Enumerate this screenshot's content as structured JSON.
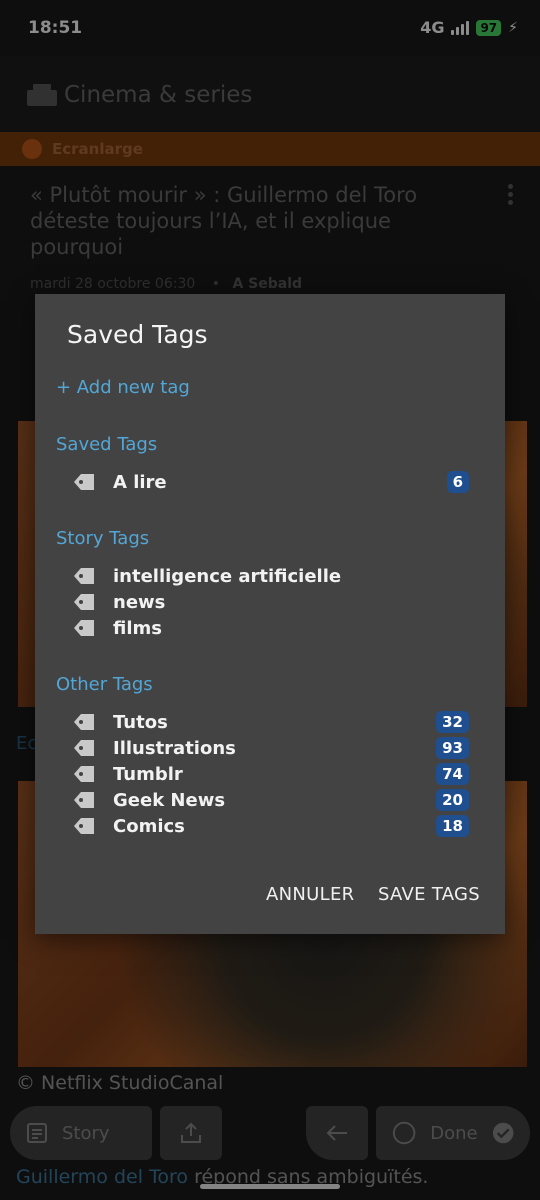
{
  "status_bar": {
    "time": "18:51",
    "network": "4G",
    "battery": "97"
  },
  "header": {
    "title": "Cinema & series"
  },
  "feed": {
    "name": "Ecranlarge"
  },
  "story": {
    "title": "« Plutôt mourir » : Guillermo del Toro déteste toujours l’IA, et il explique pourquoi",
    "date": "mardi 28 octobre 06:30",
    "separator": "•",
    "author": "A Sebald",
    "side_link": "Ec",
    "caption": "© Netflix StudioCanal",
    "body_link": "Guillermo del Toro",
    "body_rest": " répond sans ambiguïtés."
  },
  "bottom_bar": {
    "story_label": "Story",
    "done_label": "Done"
  },
  "dialog": {
    "title": "Saved Tags",
    "add_tag": "+ Add new tag",
    "saved_section": "Saved Tags",
    "saved_tags": [
      {
        "label": "A lire",
        "count": "6"
      }
    ],
    "story_section": "Story Tags",
    "story_tags": [
      {
        "label": "intelligence artificielle"
      },
      {
        "label": "news"
      },
      {
        "label": "films"
      }
    ],
    "other_section": "Other Tags",
    "other_tags": [
      {
        "label": "Tutos",
        "count": "32"
      },
      {
        "label": "Illustrations",
        "count": "93"
      },
      {
        "label": "Tumblr",
        "count": "74"
      },
      {
        "label": "Geek News",
        "count": "20"
      },
      {
        "label": "Comics",
        "count": "18"
      }
    ],
    "cancel_label": "ANNULER",
    "save_label": "SAVE TAGS"
  },
  "colors": {
    "accent": "#53a6d6",
    "count_badge": "#1f4f8f",
    "dialog_bg": "#434343",
    "feed_bar": "#7a3d0e"
  }
}
